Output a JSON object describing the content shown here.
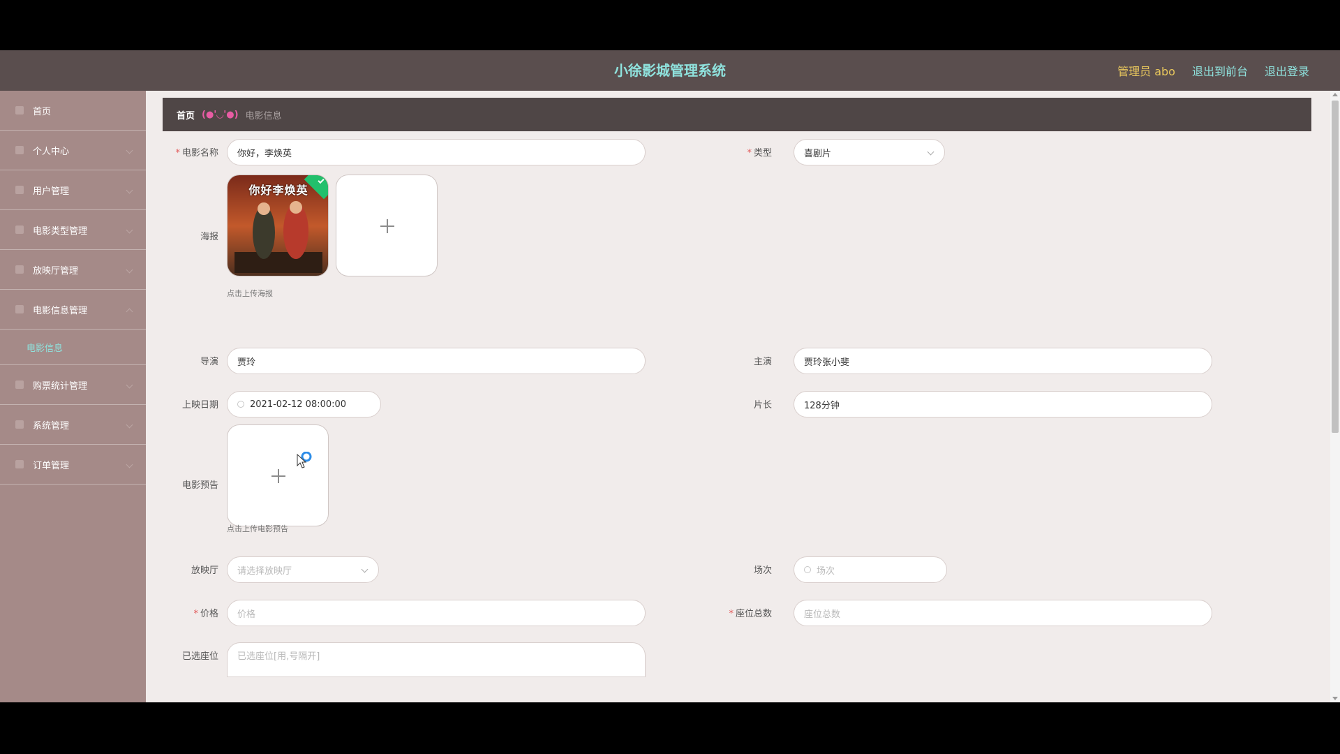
{
  "header": {
    "title": "小徐影城管理系统",
    "admin_label": "管理员 abo",
    "to_front": "退出到前台",
    "logout": "退出登录"
  },
  "sidebar": {
    "items": [
      {
        "label": "首页",
        "icon": "home-icon"
      },
      {
        "label": "个人中心",
        "icon": "user-icon"
      },
      {
        "label": "用户管理",
        "icon": "list-icon"
      },
      {
        "label": "电影类型管理",
        "icon": "film-icon"
      },
      {
        "label": "放映厅管理",
        "icon": "hall-icon"
      },
      {
        "label": "电影信息管理",
        "icon": "info-icon"
      },
      {
        "label": "购票统计管理",
        "icon": "grid-icon"
      },
      {
        "label": "系统管理",
        "icon": "gear-icon"
      },
      {
        "label": "订单管理",
        "icon": "order-icon"
      }
    ],
    "sub_item": "电影信息"
  },
  "breadcrumb": {
    "home": "首页",
    "separator": "(●'◡'●)",
    "current": "电影信息"
  },
  "form": {
    "movie_name": {
      "label": "电影名称",
      "value": "你好，李焕英"
    },
    "type": {
      "label": "类型",
      "value": "喜剧片"
    },
    "poster": {
      "label": "海报",
      "hint": "点击上传海报",
      "poster_text": "你好李焕英"
    },
    "director": {
      "label": "导演",
      "value": "贾玲"
    },
    "actors": {
      "label": "主演",
      "value": "贾玲张小斐"
    },
    "release_date": {
      "label": "上映日期",
      "value": "2021-02-12 08:00:00"
    },
    "duration": {
      "label": "片长",
      "value": "128分钟"
    },
    "trailer": {
      "label": "电影预告",
      "hint": "点击上传电影预告"
    },
    "hall": {
      "label": "放映厅",
      "placeholder": "请选择放映厅"
    },
    "session": {
      "label": "场次",
      "placeholder": "场次"
    },
    "price": {
      "label": "价格",
      "placeholder": "价格"
    },
    "seat_total": {
      "label": "座位总数",
      "placeholder": "座位总数"
    },
    "selected_seats": {
      "label": "已选座位",
      "placeholder": "已选座位[用,号隔开]"
    }
  },
  "colors": {
    "header_bg": "#5a4e4e",
    "title": "#8fe2dd",
    "admin": "#e9c85d",
    "sidebar_bg": "#a58a88",
    "breadcrumb_bg": "#4f4646",
    "content_bg": "#f1eceb",
    "required": "#e25959",
    "success": "#22c06c"
  }
}
